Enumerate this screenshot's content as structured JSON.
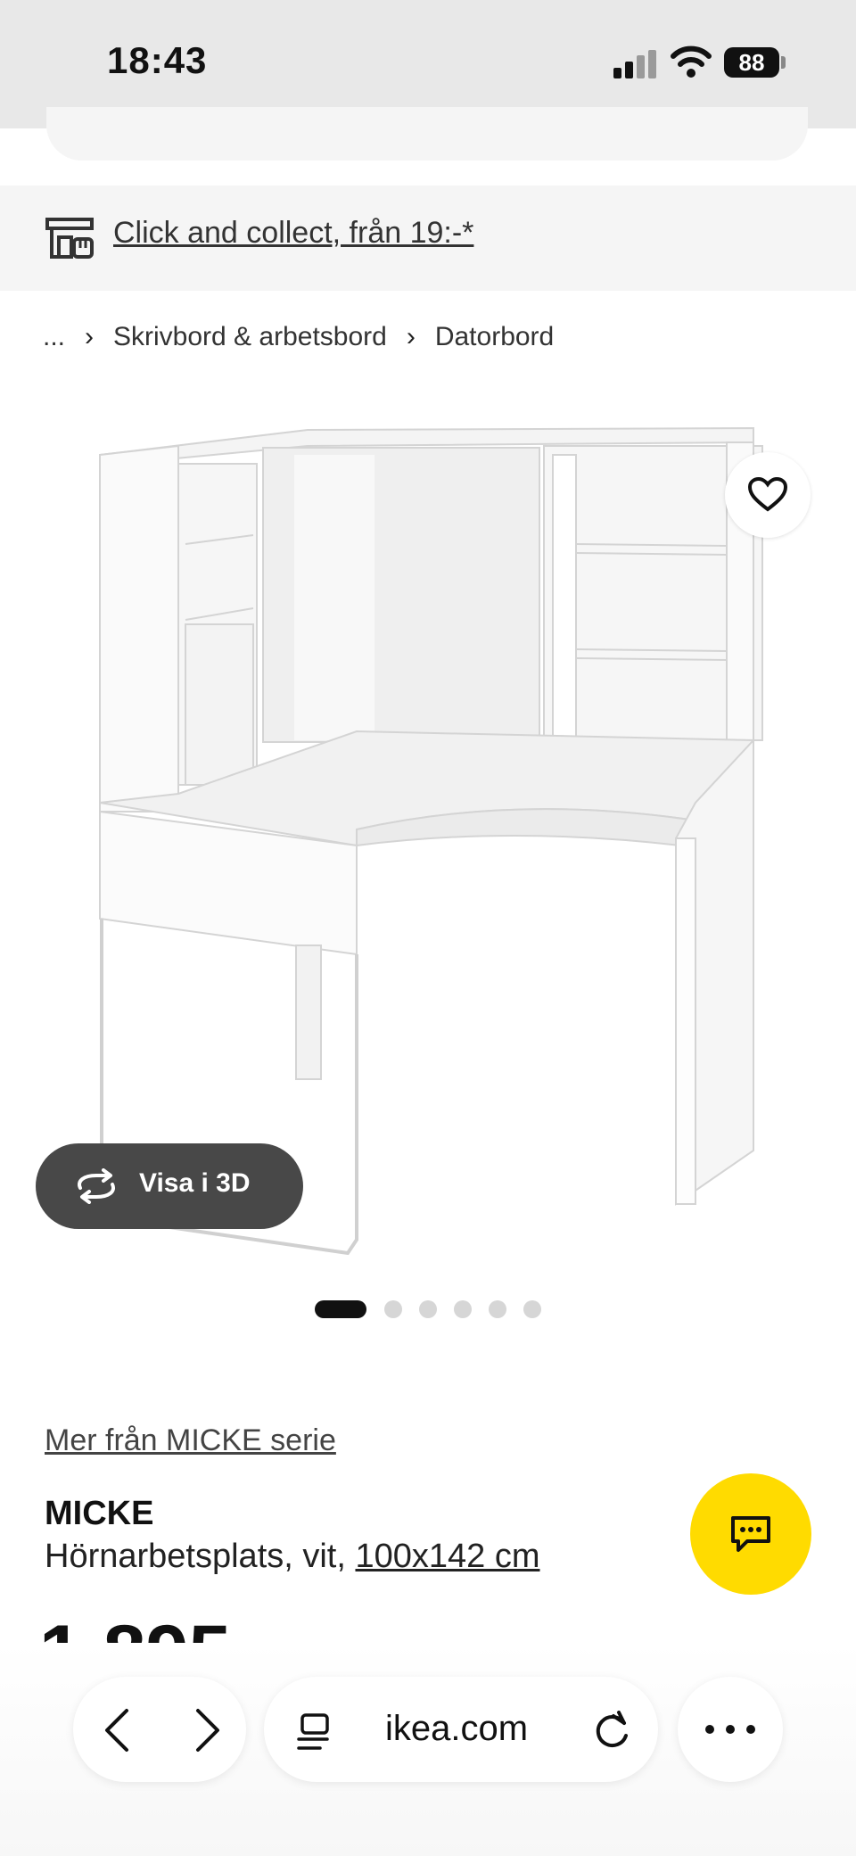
{
  "status_bar": {
    "time": "18:43",
    "battery": "88"
  },
  "promo": {
    "click_collect": "Click and collect, från 19:-*"
  },
  "breadcrumb": {
    "ellipsis": "...",
    "items": [
      "Skrivbord & arbetsbord",
      "Datorbord"
    ]
  },
  "gallery": {
    "view3d_label": "Visa i 3D",
    "dot_count": 6,
    "active_index": 0
  },
  "product": {
    "series_link": "Mer från MICKE serie",
    "name": "MICKE",
    "description": "Hörnarbetsplats, vit,",
    "size": "100x142 cm",
    "price": "1 895"
  },
  "browser": {
    "url": "ikea.com"
  },
  "colors": {
    "brand_yellow": "#ffdb00",
    "text": "#111111",
    "band": "#f5f5f5"
  }
}
